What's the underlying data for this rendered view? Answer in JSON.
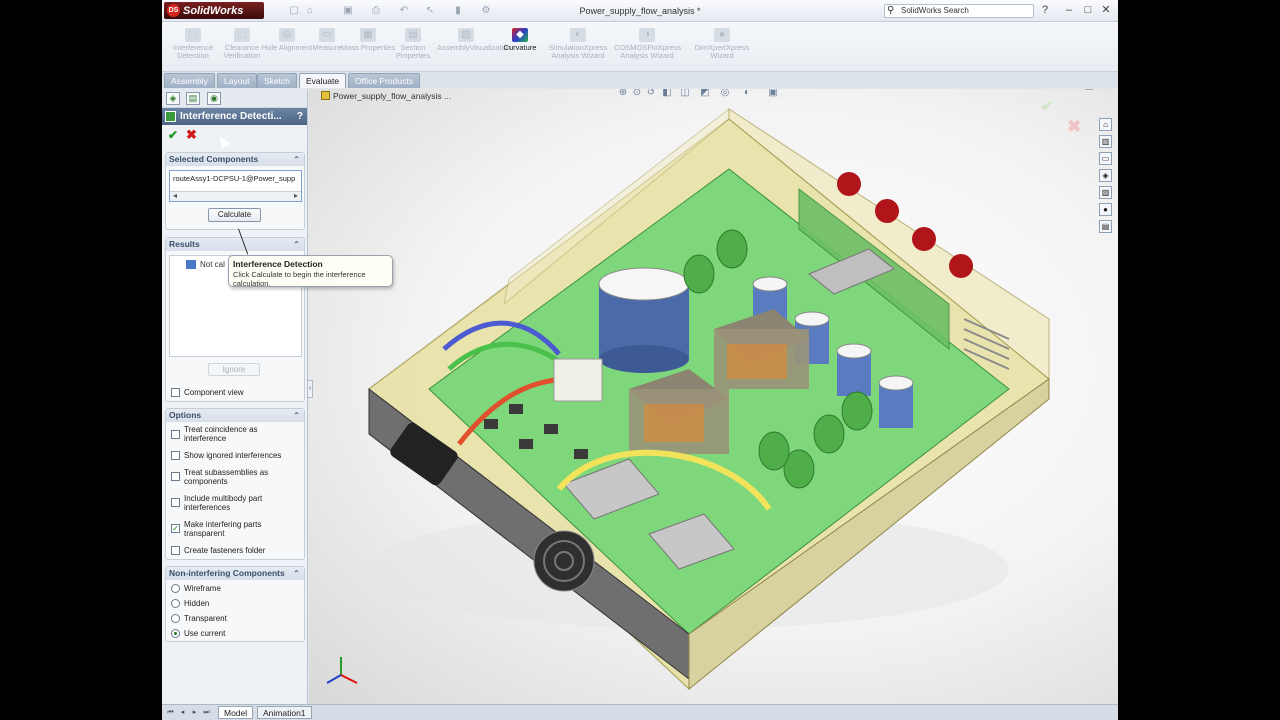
{
  "app": {
    "name": "SolidWorks",
    "doc_title": "Power_supply_flow_analysis *",
    "search_placeholder": "SolidWorks Search"
  },
  "toolbar": {
    "tools": [
      {
        "label": "Interference Detection",
        "enabled": false
      },
      {
        "label": "Clearance Verification",
        "enabled": false
      },
      {
        "label": "Hole Alignment",
        "enabled": false
      },
      {
        "label": "Measure",
        "enabled": false
      },
      {
        "label": "Mass Properties",
        "enabled": false
      },
      {
        "label": "Section Properties",
        "enabled": false
      },
      {
        "label": "AssemblyVisualization",
        "enabled": false
      },
      {
        "label": "Curvature",
        "enabled": true
      },
      {
        "label": "SimulationXpress Analysis Wizard",
        "enabled": false
      },
      {
        "label": "COSMOSFloXpress Analysis Wizard",
        "enabled": false
      },
      {
        "label": "DimXpertXpress Wizard",
        "enabled": false
      }
    ]
  },
  "tabs": [
    "Assembly",
    "Layout",
    "Sketch",
    "Evaluate",
    "Office Products"
  ],
  "active_tab": "Evaluate",
  "property_manager": {
    "title": "Interference Detecti...",
    "help": "?",
    "selected_components": {
      "heading": "Selected Components",
      "value": "routeAssy1-DCPSU-1@Power_supp",
      "calculate_label": "Calculate"
    },
    "results": {
      "heading": "Results",
      "item": "Not cal",
      "ignore_label": "Ignore",
      "component_view_label": "Component view"
    },
    "options": {
      "heading": "Options",
      "items": [
        {
          "label": "Treat coincidence as interference",
          "checked": false
        },
        {
          "label": "Show ignored interferences",
          "checked": false
        },
        {
          "label": "Treat subassemblies as components",
          "checked": false
        },
        {
          "label": "Include multibody part interferences",
          "checked": false
        },
        {
          "label": "Make interfering parts transparent",
          "checked": true
        },
        {
          "label": "Create fasteners folder",
          "checked": false
        }
      ]
    },
    "non_interfering": {
      "heading": "Non-interfering Components",
      "items": [
        {
          "label": "Wireframe",
          "selected": false
        },
        {
          "label": "Hidden",
          "selected": false
        },
        {
          "label": "Transparent",
          "selected": false
        },
        {
          "label": "Use current",
          "selected": true
        }
      ]
    }
  },
  "tooltip": {
    "title": "Interference Detection",
    "body": "Click Calculate to begin the interference calculation."
  },
  "viewport": {
    "doc_name": "Power_supply_flow_analysis ..."
  },
  "bottom_tabs": [
    "Model",
    "Animation1"
  ],
  "colors": {
    "board": "#7ed77a",
    "enclosure": "#e8e2a6",
    "accent": "#4d6584"
  }
}
